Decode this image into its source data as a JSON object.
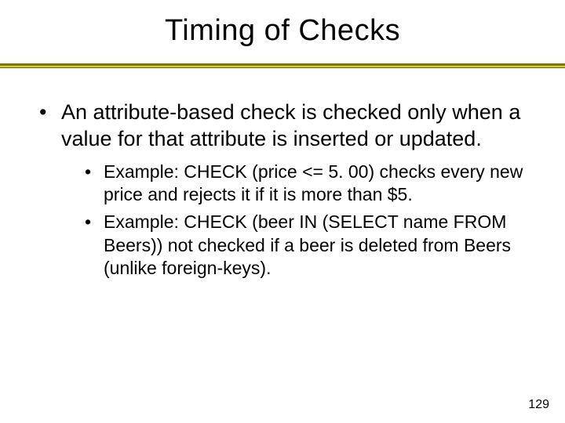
{
  "title": "Timing of Checks",
  "bullets": {
    "main": "An attribute-based check is checked only when a value for that attribute is inserted or updated.",
    "sub1": "Example: CHECK (price <= 5. 00) checks every new price and rejects it if it is more than $5.",
    "sub2": "Example: CHECK (beer IN (SELECT name FROM Beers)) not checked if a beer is deleted from Beers (unlike foreign-keys)."
  },
  "page_number": "129"
}
